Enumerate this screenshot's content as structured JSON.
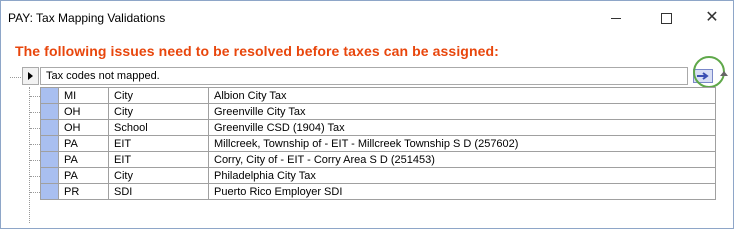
{
  "window": {
    "title": "PAY: Tax Mapping Validations",
    "controls": {
      "minimize": "minimize",
      "maximize": "maximize",
      "close": "close"
    }
  },
  "warning_text": "The following issues need to be resolved before taxes can be assigned:",
  "group": {
    "label": "Tax codes not mapped."
  },
  "rows": [
    {
      "state": "MI",
      "type": "City",
      "description": "Albion City Tax"
    },
    {
      "state": "OH",
      "type": "City",
      "description": "Greenville City Tax"
    },
    {
      "state": "OH",
      "type": "School",
      "description": "Greenville CSD (1904) Tax"
    },
    {
      "state": "PA",
      "type": "EIT",
      "description": "Millcreek, Township of - EIT - Millcreek Township S D (257602)"
    },
    {
      "state": "PA",
      "type": "EIT",
      "description": "Corry, City of - EIT - Corry Area S D (251453)"
    },
    {
      "state": "PA",
      "type": "City",
      "description": "Philadelphia City Tax"
    },
    {
      "state": "PR",
      "type": "SDI",
      "description": "Puerto Rico Employer SDI"
    }
  ],
  "colors": {
    "warning": "#e8460c",
    "selector": "#a9bff0",
    "highlight_circle": "#5fa84a"
  },
  "icons": [
    "expand-arrow-icon",
    "navigate-arrow-icon",
    "scroll-up-icon"
  ]
}
